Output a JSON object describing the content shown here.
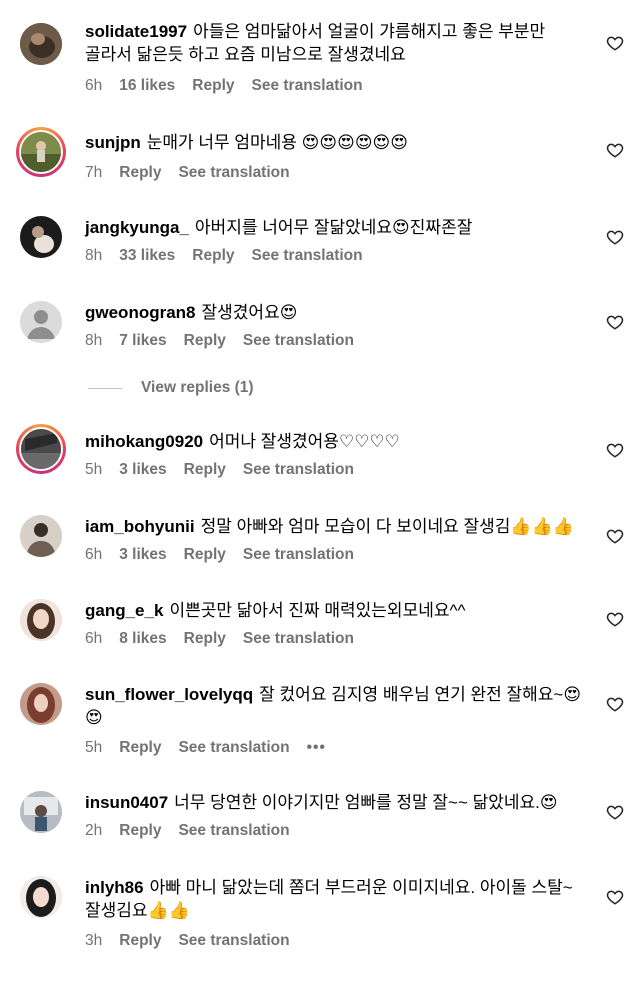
{
  "comments": [
    {
      "username": "solidate1997",
      "text": "아들은 엄마닮아서 얼굴이 갸름해지고 좋은 부분만 골라서 닮은듯 하고 요즘 미남으로 잘생겼네요",
      "time": "6h",
      "likes": "16 likes",
      "reply": "Reply",
      "translate": "See translation",
      "avatar": "photo",
      "avatar_color": "#5a4a3c"
    },
    {
      "username": "sunjpn",
      "text": "눈매가 너무 엄마네용 😍😍😍😍😍😍",
      "time": "7h",
      "likes": "",
      "reply": "Reply",
      "translate": "See translation",
      "avatar": "story-ring",
      "avatar_color": "#6b7b3a"
    },
    {
      "username": "jangkyunga_",
      "text": "아버지를 너어무 잘닮았네요😍진짜존잘",
      "time": "8h",
      "likes": "33 likes",
      "reply": "Reply",
      "translate": "See translation",
      "avatar": "photo",
      "avatar_color": "#1e1e1e"
    },
    {
      "username": "gweonogran8",
      "text": "잘생겼어요😍",
      "time": "8h",
      "likes": "7 likes",
      "reply": "Reply",
      "translate": "See translation",
      "avatar": "default-user-icon",
      "avatar_color": "#dbdbdb"
    },
    {
      "username": "mihokang0920",
      "text": "어머나 잘생겼어용♡♡♡♡",
      "time": "5h",
      "likes": "3 likes",
      "reply": "Reply",
      "translate": "See translation",
      "avatar": "story-ring",
      "avatar_color": "#3a3a3a"
    },
    {
      "username": "iam_bohyunii",
      "text": "정말 아빠와 엄마 모습이 다 보이네요 잘생김👍👍👍",
      "time": "6h",
      "likes": "3 likes",
      "reply": "Reply",
      "translate": "See translation",
      "avatar": "photo",
      "avatar_color": "#8a7d70"
    },
    {
      "username": "gang_e_k",
      "text": "이쁜곳만 닮아서 진짜 매력있는외모네요^^",
      "time": "6h",
      "likes": "8 likes",
      "reply": "Reply",
      "translate": "See translation",
      "avatar": "photo",
      "avatar_color": "#c9a08a"
    },
    {
      "username": "sun_flower_lovelyqq",
      "text": "잘 컸어요 김지영 배우님 연기 완전 잘해요~😍😍",
      "time": "5h",
      "likes": "",
      "reply": "Reply",
      "translate": "See translation",
      "more": "•••",
      "avatar": "photo",
      "avatar_color": "#b88a78"
    },
    {
      "username": "insun0407",
      "text": "너무 당연한 이야기지만 엄빠를 정말 잘~~ 닮았네요.😍",
      "time": "2h",
      "likes": "",
      "reply": "Reply",
      "translate": "See translation",
      "avatar": "photo",
      "avatar_color": "#9aa0a6"
    },
    {
      "username": "inlyh86",
      "text": "아빠 마니 닮았는데 쫌더 부드러운 이미지네요. 아이돌 스탈~ 잘생김요👍👍",
      "time": "3h",
      "likes": "",
      "reply": "Reply",
      "translate": "See translation",
      "avatar": "photo",
      "avatar_color": "#2b2b2b"
    }
  ],
  "view_replies": "View replies (1)",
  "icons": {
    "like": "heart-outline-icon",
    "default_avatar": "user-silhouette-icon"
  }
}
